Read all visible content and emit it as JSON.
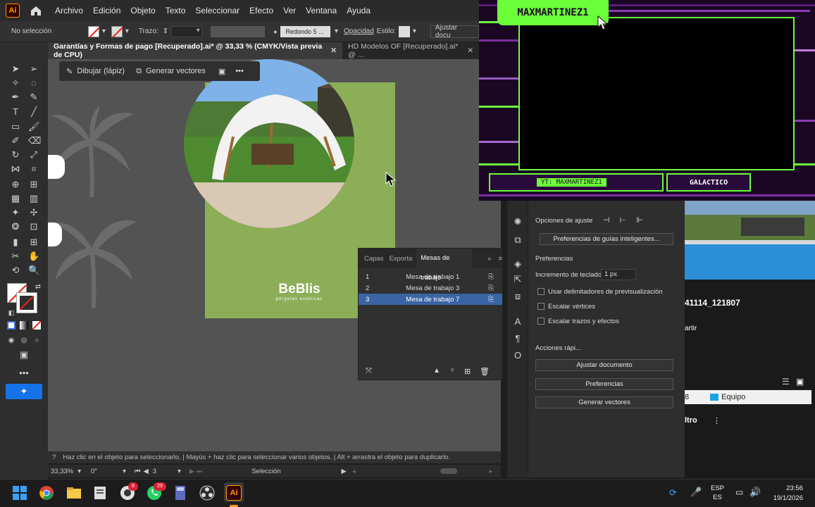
{
  "app": {
    "logo": "Ai",
    "accent": "#ff9a00"
  },
  "menu": [
    "Archivo",
    "Edición",
    "Objeto",
    "Texto",
    "Seleccionar",
    "Efecto",
    "Ver",
    "Ventana",
    "Ayuda"
  ],
  "control": {
    "selection": "No selección",
    "stroke_label": "Trazo:",
    "brush": "Redondo 5 ...",
    "opacity": "Opacidad",
    "style": "Estilo:",
    "adjust": "Ajustar docu"
  },
  "tabs": [
    {
      "label": "Garantías y Formas de pago [Recuperado].ai* @ 33,33 % (CMYK/Vista previa de CPU)"
    },
    {
      "label": "HD Modelos OF [Recuperado].ai* @ ..."
    }
  ],
  "context": {
    "draw": "Dibujar (lápiz)",
    "vectorize": "Generar vectores"
  },
  "artboard": {
    "brand": "BeBlis",
    "tagline": "pérgolas estéticas",
    "bg": "#8cae57"
  },
  "layers": {
    "tabs": [
      "Capas",
      "Exporta",
      "Mesas de trabajo"
    ],
    "rows": [
      {
        "num": "1",
        "name": "Mesa de trabajo 1"
      },
      {
        "num": "2",
        "name": "Mesa de trabajo 3"
      },
      {
        "num": "3",
        "name": "Mesa de trabajo 7"
      }
    ]
  },
  "status": {
    "hint": "Haz clic en el objeto para seleccionarlo.  |  Mayús + haz clic para seleccionar varios objetos.  |  Alt + arrastra el objeto para duplicarlo."
  },
  "bottom": {
    "zoom": "33,33%",
    "angle": "0°",
    "artboard": "3",
    "tool": "Selección"
  },
  "props": {
    "snap": "Opciones de ajuste",
    "smart_guides": "Preferencias de guías inteligentes...",
    "prefs": "Preferencias",
    "keyboard": "Incremento de teclado:",
    "keyboard_val": "1 px",
    "checks": [
      "Usar delimitadores de previsualización",
      "Escalar vértices",
      "Escalar trazos y efectos"
    ],
    "quick": "Acciones rápi...",
    "buttons": [
      "Ajustar documento",
      "Preferencias",
      "Generar vectores"
    ]
  },
  "stream": {
    "name": "MAXMARTINEZ1",
    "yt": "YT: MAXMARTINEZ1",
    "tag": "GALACTICO"
  },
  "farright": {
    "file": "41114_121807",
    "share": "artir",
    "team": "Equipo",
    "num": "8",
    "filter": "ltro"
  },
  "taskbar": {
    "lang": "ESP",
    "lang2": "ES",
    "time": "23:56",
    "date": "19/1/2026",
    "badge": "29"
  }
}
